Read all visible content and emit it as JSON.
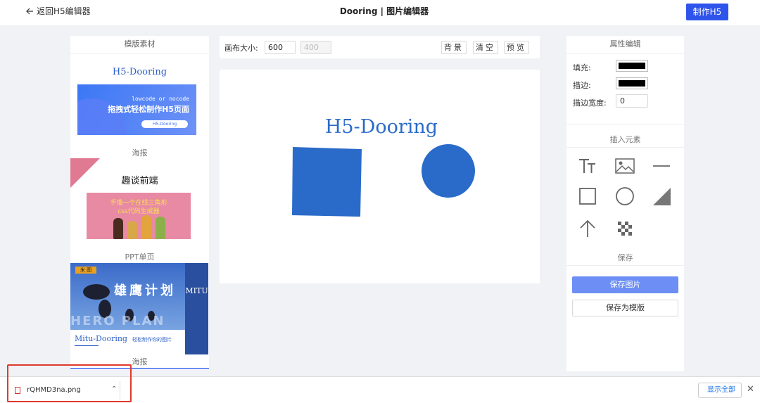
{
  "header": {
    "back_label": "返回H5编辑器",
    "title": "Dooring | 图片编辑器",
    "make_button": "制作H5"
  },
  "left_panel": {
    "title": "模版素材",
    "templates": [
      {
        "title": "H5-Dooring",
        "card_line1": "lowcode or nocode",
        "card_line2": "拖拽式轻松制作H5页面",
        "card_pill": "H5-Dooring",
        "caption": "海报"
      },
      {
        "title": "趣谈前端",
        "card_line1": "手撸一个在线三角形",
        "card_line2": "css代码生成器",
        "caption": "PPT单页"
      },
      {
        "card_big": "雄鹰计划",
        "card_ghost": "HERO PLAN",
        "card_side": "MITU",
        "card_badge": "米 图",
        "card_foot_title": "Mitu-Dooring",
        "card_foot_sub": "轻松制作你的图片",
        "caption": "海报"
      }
    ]
  },
  "toolbar": {
    "size_label": "画布大小:",
    "width": "600",
    "height": "400",
    "bg_button": "背景",
    "clear_button": "清空",
    "preview_button": "预览"
  },
  "canvas": {
    "text": "H5-Dooring",
    "fill_color": "#2a6bc9"
  },
  "right_panel": {
    "title": "属性编辑",
    "fill_label": "填充:",
    "stroke_label": "描边:",
    "stroke_width_label": "描边宽度:",
    "stroke_width": "0",
    "fill_color": "#000000",
    "stroke_color": "#000000",
    "insert_title": "插入元素",
    "tools": [
      "text-icon",
      "image-icon",
      "line-icon",
      "rect-icon",
      "circle-icon",
      "triangle-icon",
      "arrow-icon",
      "mosaic-icon"
    ],
    "save_title": "保存",
    "save_image": "保存图片",
    "save_template": "保存为模版"
  },
  "download_bar": {
    "file_name": "rQHMD3na.png",
    "show_all": "显示全部"
  }
}
